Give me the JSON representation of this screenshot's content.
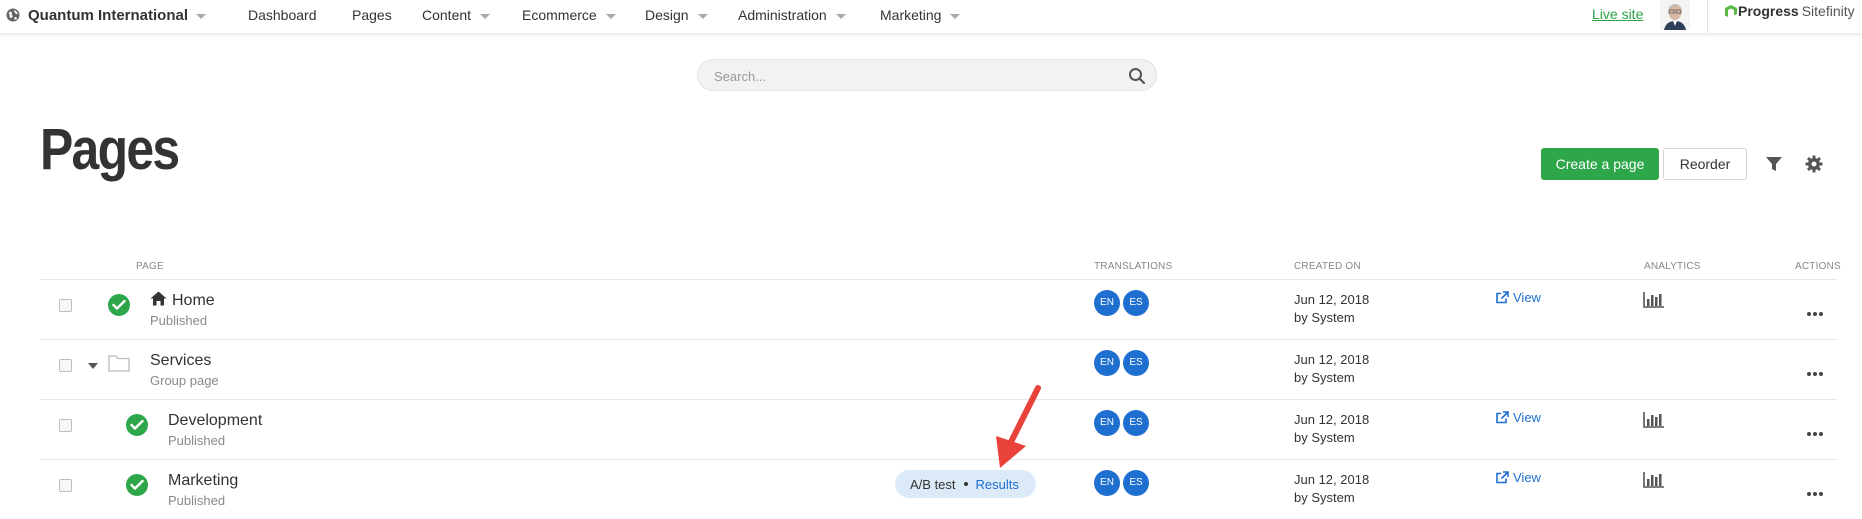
{
  "topnav": {
    "site_name": "Quantum International",
    "items": [
      "Dashboard",
      "Pages",
      "Content",
      "Ecommerce",
      "Design",
      "Administration",
      "Marketing"
    ],
    "live_site": "Live site",
    "logo_progress": "Progress",
    "logo_sitefinity": "Sitefinity"
  },
  "search": {
    "placeholder": "Search..."
  },
  "page_title": "Pages",
  "toolbar": {
    "create_label": "Create a page",
    "reorder_label": "Reorder"
  },
  "table": {
    "headers": {
      "page": "PAGE",
      "translations": "TRANSLATIONS",
      "created_on": "CREATED ON",
      "analytics": "ANALYTICS",
      "actions": "ACTIONS"
    },
    "rows": [
      {
        "name": "Home",
        "status": "Published",
        "langs": [
          "EN",
          "ES"
        ],
        "date": "Jun 12, 2018",
        "by": "by System",
        "view": "View"
      },
      {
        "name": "Services",
        "status": "Group page",
        "langs": [
          "EN",
          "ES"
        ],
        "date": "Jun 12, 2018",
        "by": "by System",
        "view": ""
      },
      {
        "name": "Development",
        "status": "Published",
        "langs": [
          "EN",
          "ES"
        ],
        "date": "Jun 12, 2018",
        "by": "by System",
        "view": "View"
      },
      {
        "name": "Marketing",
        "status": "Published",
        "langs": [
          "EN",
          "ES"
        ],
        "date": "Jun 12, 2018",
        "by": "by System",
        "view": "View"
      }
    ]
  },
  "ab_test": {
    "label": "A/B test",
    "results": "Results"
  },
  "colors": {
    "accent_green": "#2ea64a",
    "link_blue": "#1f6fd1",
    "arrow_red": "#e8423a"
  }
}
